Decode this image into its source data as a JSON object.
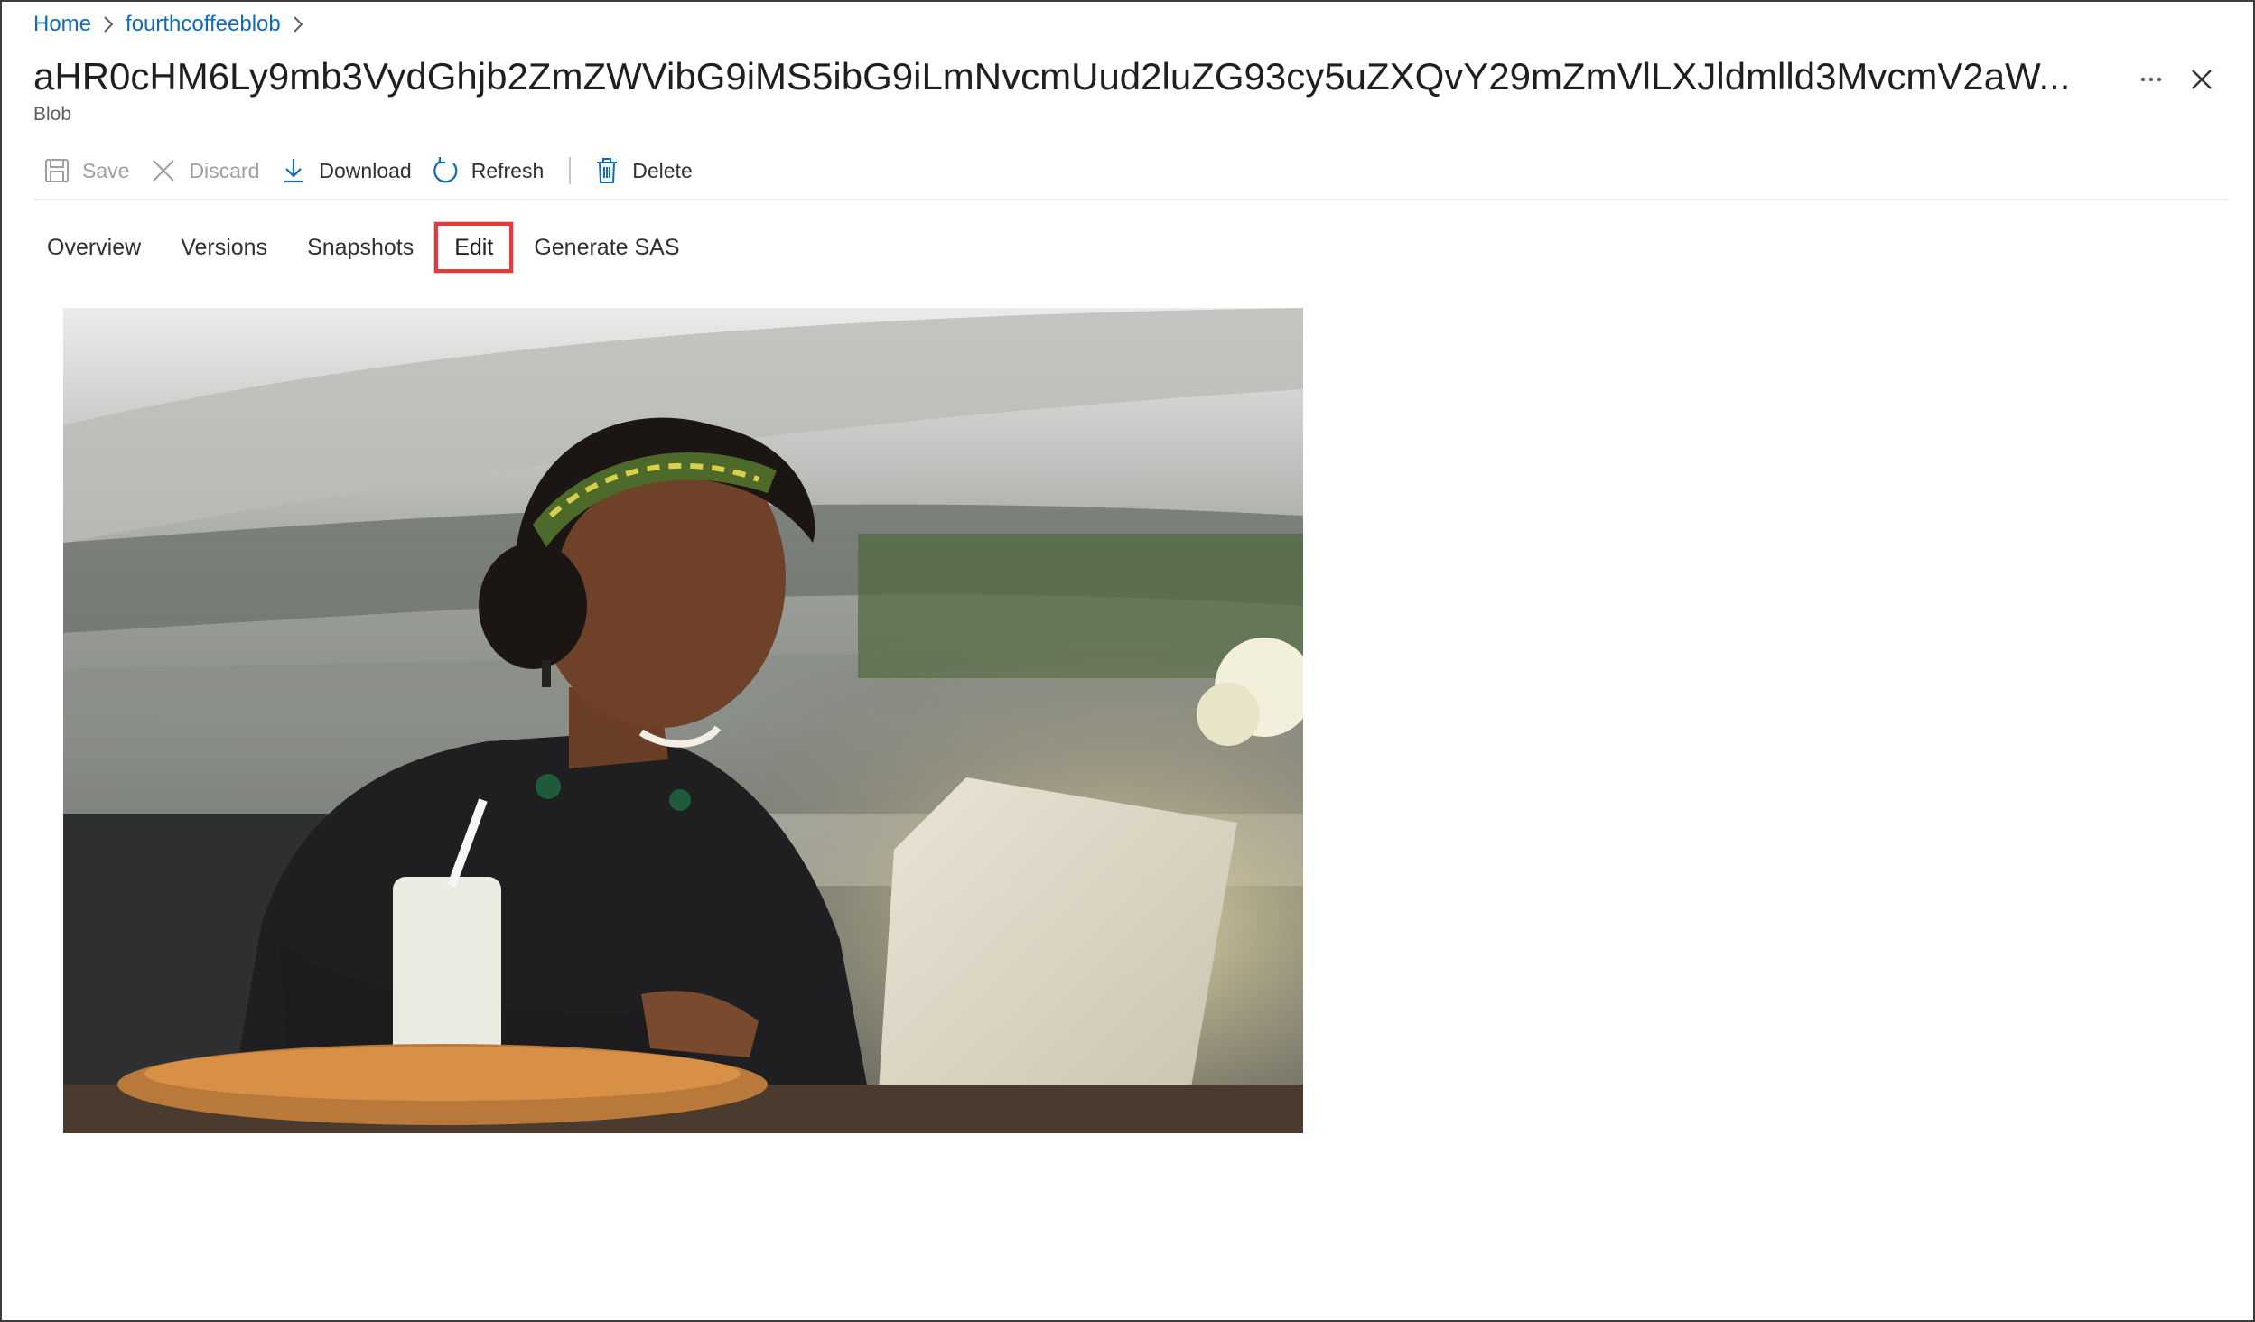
{
  "breadcrumb": {
    "items": [
      "Home",
      "fourthcoffeeblob"
    ]
  },
  "header": {
    "title": "aHR0cHM6Ly9mb3VydGhjb2ZmZWVibG9iMS5ibG9iLmNvcmUud2luZG93cy5uZXQvY29mZmVlLXJldmlld3MvcmV2aW...",
    "subtitle": "Blob",
    "more_icon": "ellipsis-icon",
    "close_icon": "close-icon"
  },
  "toolbar": {
    "save": "Save",
    "discard": "Discard",
    "download": "Download",
    "refresh": "Refresh",
    "delete": "Delete"
  },
  "tabs": {
    "overview": "Overview",
    "versions": "Versions",
    "snapshots": "Snapshots",
    "edit": "Edit",
    "generate_sas": "Generate SAS",
    "selected": "Edit"
  },
  "colors": {
    "link": "#0f6cbd",
    "highlight": "#e03c3c",
    "icon_blue": "#0f6cbd",
    "disabled": "#a19f9d"
  }
}
